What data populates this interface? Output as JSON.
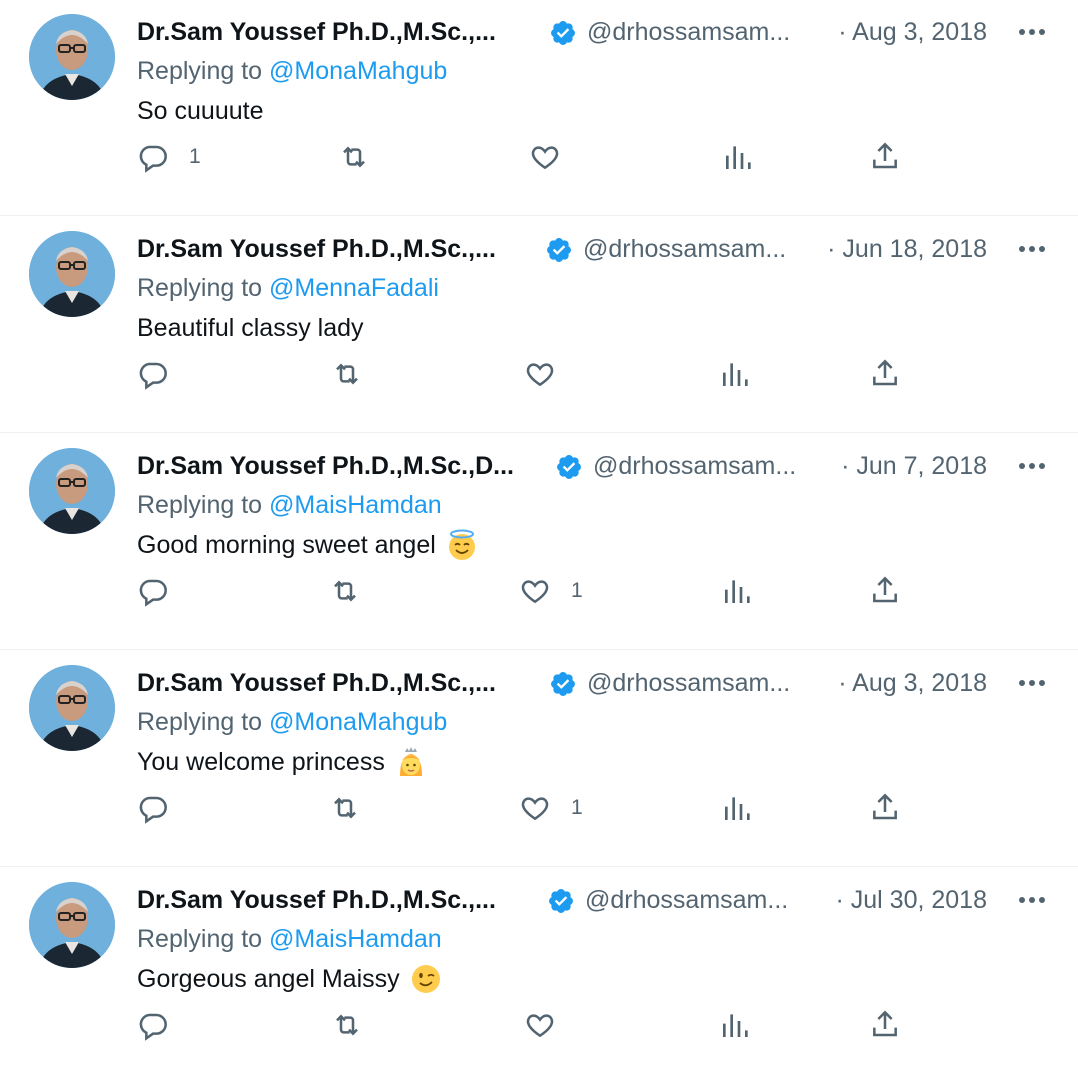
{
  "colors": {
    "text": "#0f1419",
    "muted": "#536471",
    "link": "#1d9bf0",
    "divider": "#eff3f4",
    "verified": "#1d9bf0"
  },
  "tweets": [
    {
      "name": "Dr.Sam Youssef Ph.D.,M.Sc.,...",
      "handle": "@drhossamsam...",
      "date": "· Aug 3, 2018",
      "replying_prefix": "Replying to ",
      "replying_to": "@MonaMahgub",
      "text": "So cuuuute",
      "emoji": "",
      "reply_count": "1",
      "like_count": ""
    },
    {
      "name": "Dr.Sam Youssef Ph.D.,M.Sc.,...",
      "handle": "@drhossamsam...",
      "date": "· Jun 18, 2018",
      "replying_prefix": "Replying to ",
      "replying_to": "@MennaFadali",
      "text": "Beautiful classy lady",
      "emoji": "",
      "reply_count": "",
      "like_count": ""
    },
    {
      "name": "Dr.Sam Youssef Ph.D.,M.Sc.,D...",
      "handle": "@drhossamsam...",
      "date": "· Jun 7, 2018",
      "replying_prefix": "Replying to ",
      "replying_to": "@MaisHamdan",
      "text": "Good morning sweet angel",
      "emoji": "smiling-face-with-halo",
      "reply_count": "",
      "like_count": "1"
    },
    {
      "name": "Dr.Sam Youssef Ph.D.,M.Sc.,...",
      "handle": "@drhossamsam...",
      "date": "· Aug 3, 2018",
      "replying_prefix": "Replying to ",
      "replying_to": "@MonaMahgub",
      "text": "You welcome princess",
      "emoji": "princess",
      "reply_count": "",
      "like_count": "1"
    },
    {
      "name": "Dr.Sam Youssef Ph.D.,M.Sc.,...",
      "handle": "@drhossamsam...",
      "date": "· Jul 30, 2018",
      "replying_prefix": "Replying to ",
      "replying_to": "@MaisHamdan",
      "text": "Gorgeous angel Maissy",
      "emoji": "winking-face",
      "reply_count": "",
      "like_count": ""
    }
  ]
}
